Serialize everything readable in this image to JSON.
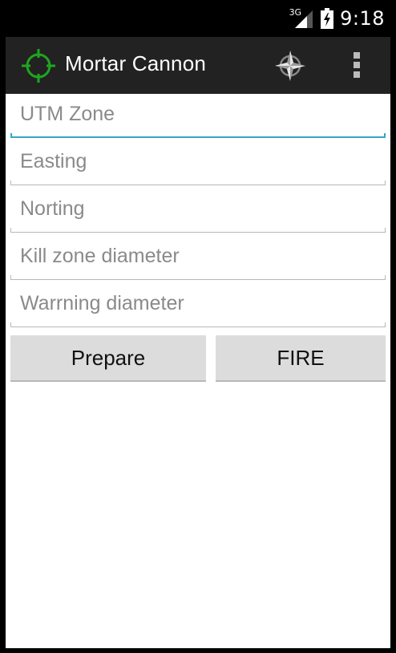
{
  "status_bar": {
    "network": "3G",
    "time": "9:18"
  },
  "action_bar": {
    "title": "Mortar Cannon",
    "app_icon": "crosshair-icon",
    "compass_icon": "compass-icon",
    "overflow_icon": "overflow-menu-icon"
  },
  "form": {
    "utm_zone": {
      "placeholder": "UTM Zone",
      "value": ""
    },
    "easting": {
      "placeholder": "Easting",
      "value": ""
    },
    "norting": {
      "placeholder": "Norting",
      "value": ""
    },
    "kill_zone_diameter": {
      "placeholder": "Kill zone diameter",
      "value": ""
    },
    "warrning_diameter": {
      "placeholder": "Warrning diameter",
      "value": ""
    }
  },
  "buttons": {
    "prepare": "Prepare",
    "fire": "FIRE"
  },
  "colors": {
    "focus_accent": "#33a6c8",
    "app_icon_green": "#1fa61f",
    "action_bar_bg": "#222222"
  }
}
